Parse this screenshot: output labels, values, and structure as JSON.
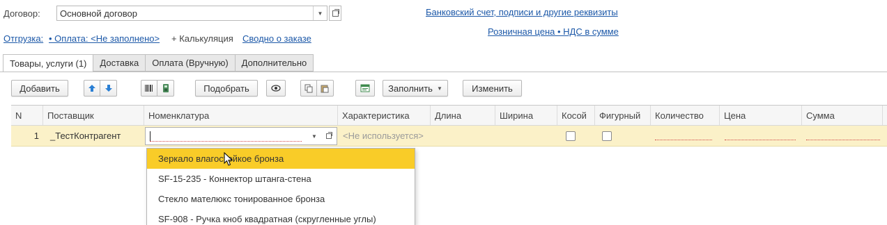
{
  "form": {
    "contract_label": "Договор:",
    "contract_value": "Основной договор",
    "links_row": {
      "shipment": "Отгрузка:",
      "payment": "• Оплата: <Не заполнено>",
      "calc": "+ Калькуляция",
      "summary": "Сводно о заказе"
    },
    "right_links": {
      "bank": "Банковский счет, подписи и другие реквизиты",
      "retail": "Розничная цена • НДС в сумме"
    }
  },
  "tabs": [
    {
      "label": "Товары, услуги (1)",
      "active": true
    },
    {
      "label": "Доставка"
    },
    {
      "label": "Оплата (Вручную)"
    },
    {
      "label": "Дополнительно"
    }
  ],
  "toolbar": {
    "add": "Добавить",
    "select": "Подобрать",
    "fill": "Заполнить",
    "change": "Изменить",
    "icons": [
      "arrow-up-icon",
      "arrow-down-icon",
      "barcode-icon",
      "terminal-icon",
      "eye-icon",
      "copy-icon",
      "paste-icon",
      "form-icon"
    ]
  },
  "table": {
    "columns": [
      "N",
      "Поставщик",
      "Номенклатура",
      "Характеристика",
      "Длина",
      "Ширина",
      "Косой",
      "Фигурный",
      "Количество",
      "Цена",
      "Сумма"
    ],
    "row": {
      "n": "1",
      "supplier": "_ТестКонтрагент",
      "nomenclature": "",
      "characteristic": "<Не используется>"
    }
  },
  "dropdown": {
    "items": [
      "Зеркало влагостойкое бронза",
      "SF-15-235 - Коннектор штанга-стена",
      "Стекло мателюкс тонированное бронза",
      "SF-908 - Ручка кноб квадратная (скругленные углы)"
    ],
    "selected_index": 0
  },
  "colors": {
    "link": "#1c58a8",
    "row_highlight": "#fbf1c8",
    "selected_item": "#f9cc28"
  }
}
